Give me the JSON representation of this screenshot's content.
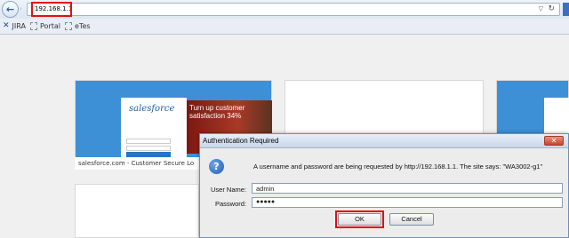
{
  "browser": {
    "url": "192.168.1.1",
    "back_glyph": "←",
    "forward_glyph": "›",
    "dropdown_glyph": "▽",
    "refresh_glyph": "↻"
  },
  "bookmarks": [
    {
      "label": "JIRA",
      "icon": "jira-icon"
    },
    {
      "label": "Portal",
      "icon": "page-icon"
    },
    {
      "label": "eTes",
      "icon": "page-icon"
    }
  ],
  "tiles": {
    "salesforce_caption": "salesforce.com - Customer Secure Lo",
    "salesforce_logo": "salesforce",
    "salesforce_ad": "Turn up customer satisfaction 34%"
  },
  "dialog": {
    "title": "Authentication Required",
    "close_glyph": "✕",
    "help_glyph": "?",
    "message": "A username and password are being requested by http://192.168.1.1. The site says: \"WA3002-g1\"",
    "username_label": "User Name:",
    "username_value": "admin",
    "password_label": "Password:",
    "password_value": "●●●●●",
    "ok_label": "OK",
    "cancel_label": "Cancel"
  },
  "colors": {
    "highlight_red": "#e01010",
    "salesforce_blue": "#3d8fd6",
    "dialog_border": "#6f8fb7"
  }
}
